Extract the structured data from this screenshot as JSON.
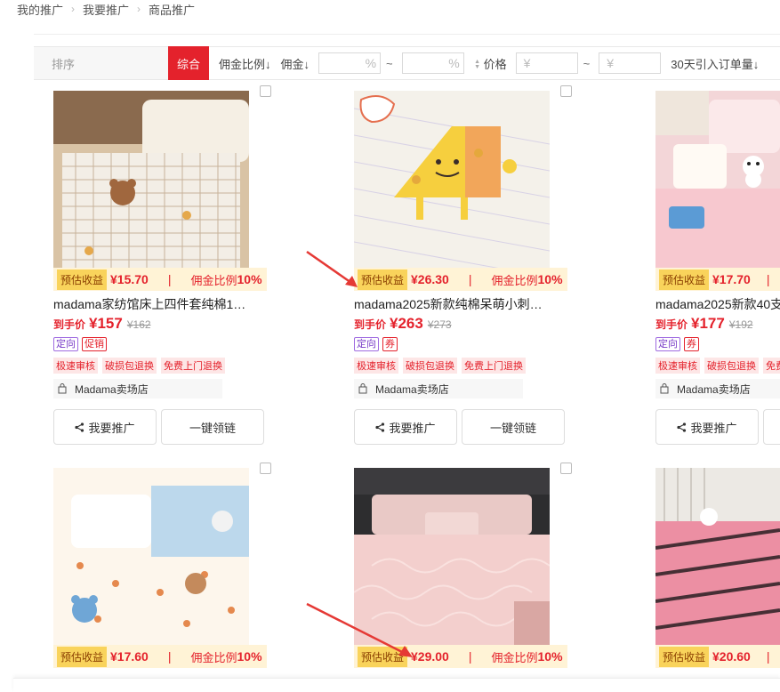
{
  "breadcrumb": [
    "我的推广",
    "我要推广",
    "商品推广"
  ],
  "sort_bar": {
    "label": "排序",
    "active": "综合",
    "items": [
      "佣金比例↓",
      "佣金↓"
    ],
    "percent_unit": "%",
    "tilde": "~",
    "price_label": "价格",
    "currency_placeholder": "¥",
    "orders_label": "30天引入订单量↓"
  },
  "labels": {
    "earn_badge": "预估收益",
    "commission_rate_label": "佣金比例",
    "final_price_label": "到手价",
    "promote_button": "我要推广",
    "get_link_button": "一键领链",
    "pipe": "|"
  },
  "products": [
    {
      "earn": "¥15.70",
      "rate": "10%",
      "title": "madama家纺馆床上四件套纯棉1…",
      "price": "¥157",
      "orig": "¥162",
      "tags": [
        {
          "text": "定向",
          "color": "purple"
        },
        {
          "text": "促销",
          "color": "red"
        }
      ],
      "services": [
        "极速审核",
        "破损包退换",
        "免费上门退换"
      ],
      "shop": "Madama卖场店",
      "image": "plaid-bedding-bear"
    },
    {
      "earn": "¥26.30",
      "rate": "10%",
      "title": "madama2025新款纯棉呆萌小刺…",
      "price": "¥263",
      "orig": "¥273",
      "tags": [
        {
          "text": "定向",
          "color": "purple"
        },
        {
          "text": "券",
          "color": "red"
        }
      ],
      "services": [
        "极速审核",
        "破损包退换",
        "免费上门退换"
      ],
      "shop": "Madama卖场店",
      "image": "cheese-mascot-bedding"
    },
    {
      "earn": "¥17.70",
      "rate": "",
      "title": "madama2025新款40支",
      "price": "¥177",
      "orig": "¥192",
      "tags": [
        {
          "text": "定向",
          "color": "purple"
        },
        {
          "text": "券",
          "color": "red"
        }
      ],
      "services": [
        "极速审核",
        "破损包退换",
        "免费"
      ],
      "shop": "Madama卖场店",
      "image": "pink-bedding-dog"
    },
    {
      "earn": "¥17.60",
      "rate": "10%",
      "image": "heart-bear-bedding"
    },
    {
      "earn": "¥29.00",
      "rate": "10%",
      "image": "pink-lace-bedding"
    },
    {
      "earn": "¥20.60",
      "rate": "",
      "image": "pink-letter-bedding"
    }
  ],
  "colors": {
    "accent": "#e4222c",
    "earn_badge_bg": "#f9d35b",
    "earn_row_bg": "#fff3d6",
    "purple_tag": "#7a3ec8",
    "service_bg": "#fde6e6",
    "annotation_arrow": "#e53935"
  },
  "icons": {
    "breadcrumb_separator": "chevron-right-icon",
    "sort_toggle": "sort-arrows-icon",
    "shop": "shop-bag-icon",
    "share": "share-icon",
    "checkbox": "checkbox-icon"
  }
}
